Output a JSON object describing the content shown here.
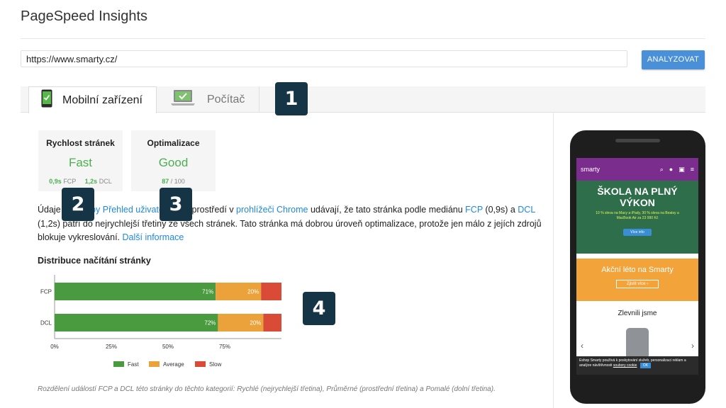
{
  "app_title": "PageSpeed Insights",
  "url_input": {
    "value": "https://www.smarty.cz/"
  },
  "analyze_button": {
    "label": "ANALYZOVAT"
  },
  "tabs": [
    {
      "label": "Mobilní zařízení",
      "active": true
    },
    {
      "label": "Počítač",
      "active": false
    }
  ],
  "callouts": [
    "1",
    "2",
    "3",
    "4"
  ],
  "cards": {
    "speed": {
      "title": "Rychlost stránek",
      "value": "Fast",
      "fcp_value": "0,9s",
      "fcp_label": "FCP",
      "dcl_value": "1,2s",
      "dcl_label": "DCL"
    },
    "optimization": {
      "title": "Optimalizace",
      "value": "Good",
      "score": "87",
      "max": "/ 100"
    }
  },
  "paragraph": {
    "p1": "Údaje",
    "p2": " ",
    "link1": "ze služby Přehled uživatelského",
    "p3": " ",
    "p4": "prostředí v ",
    "link2": "prohlížeči Chrome",
    "p5": " udávají, že tato stránka podle mediánu ",
    "link3": "FCP",
    "p6": " (0,9s) a ",
    "link4": "DCL",
    "p7": " (1,2s) patří do nejrychlejší třetiny ze všech stránek. Tato stránka má dobrou úroveň optimalizace, protože jen málo z jejích zdrojů blokuje vykreslování. ",
    "more_link": "Další informace"
  },
  "distribution_title": "Distribuce načítání stránky",
  "chart_data": {
    "type": "bar",
    "orientation": "horizontal",
    "stacked": true,
    "categories": [
      "FCP",
      "DCL"
    ],
    "series": [
      {
        "name": "Fast",
        "color": "#4a9a3f",
        "values": [
          71,
          72
        ]
      },
      {
        "name": "Average",
        "color": "#eba23a",
        "values": [
          20,
          20
        ]
      },
      {
        "name": "Slow",
        "color": "#d94a37",
        "values": [
          9,
          8
        ]
      }
    ],
    "x_ticks": [
      "0%",
      "25%",
      "50%",
      "75%"
    ],
    "xlim": [
      0,
      100
    ],
    "legend": "bottom"
  },
  "note": "Rozdělení událostí FCP a DCL této stránky do těchto kategorií: Rychlé (nejrychlejší třetina), Průměrné (prostřední třetina) a Pomalé (dolní třetina).",
  "phone_preview": {
    "brand": "smarty",
    "banner1_title": "ŠKOLA NA PLNÝ VÝKON",
    "banner1_text": "10 % sleva na Macy a iPady, 30 % sleva na Beatsy a MacBook Air za 23 990 Kč",
    "banner1_button": "Více info",
    "banner2_title": "Akční léto na Smarty",
    "banner2_button": "Zjistit více ›",
    "section_title": "Zlevnili jsme",
    "cookie_text": "Eshop Smarty používá k poskytování služeb, personalizaci reklam a analýze návštěvnosti",
    "cookie_link": "soubory cookie",
    "cookie_ok": "OK"
  }
}
